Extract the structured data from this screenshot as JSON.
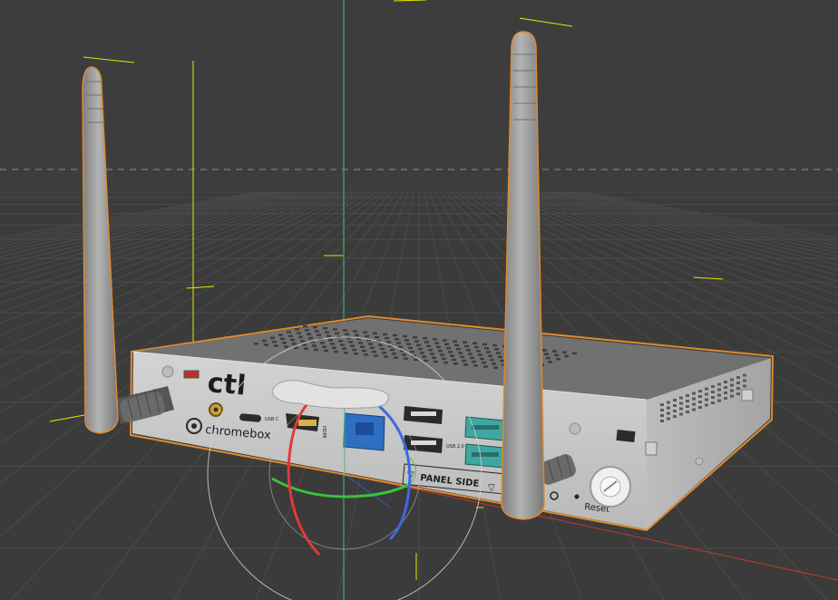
{
  "viewport": {
    "background": "#3b3b3b",
    "grid_color": "#4a4a4a",
    "horizon_color": "#9a9a9a",
    "axis_y_color": "#3fbf7f",
    "axis_x_color": "#c0392b",
    "light_guide_color": "#e6e600",
    "selection_outline_color": "#e08a2c"
  },
  "model": {
    "brand_logo": "ctl",
    "product_name": "chromebox",
    "panel_label": "PANEL SIDE",
    "reset_label": "Reset",
    "port_labels": {
      "usb_c": "USB C",
      "usb_2": "USB 2.0",
      "hdmi": "HDMI"
    },
    "body_color": "#c9c9c9",
    "top_color": "#707070",
    "usb3_color": "#3fa7a0",
    "ethernet_color": "#2f6fc2",
    "antenna_color": "#9d9d9d"
  },
  "gizmo": {
    "type": "rotate",
    "ring_colors": {
      "x": "#e03a3a",
      "y": "#3ac23a",
      "z": "#3a6be0",
      "screen": "#cfcfcf"
    }
  }
}
